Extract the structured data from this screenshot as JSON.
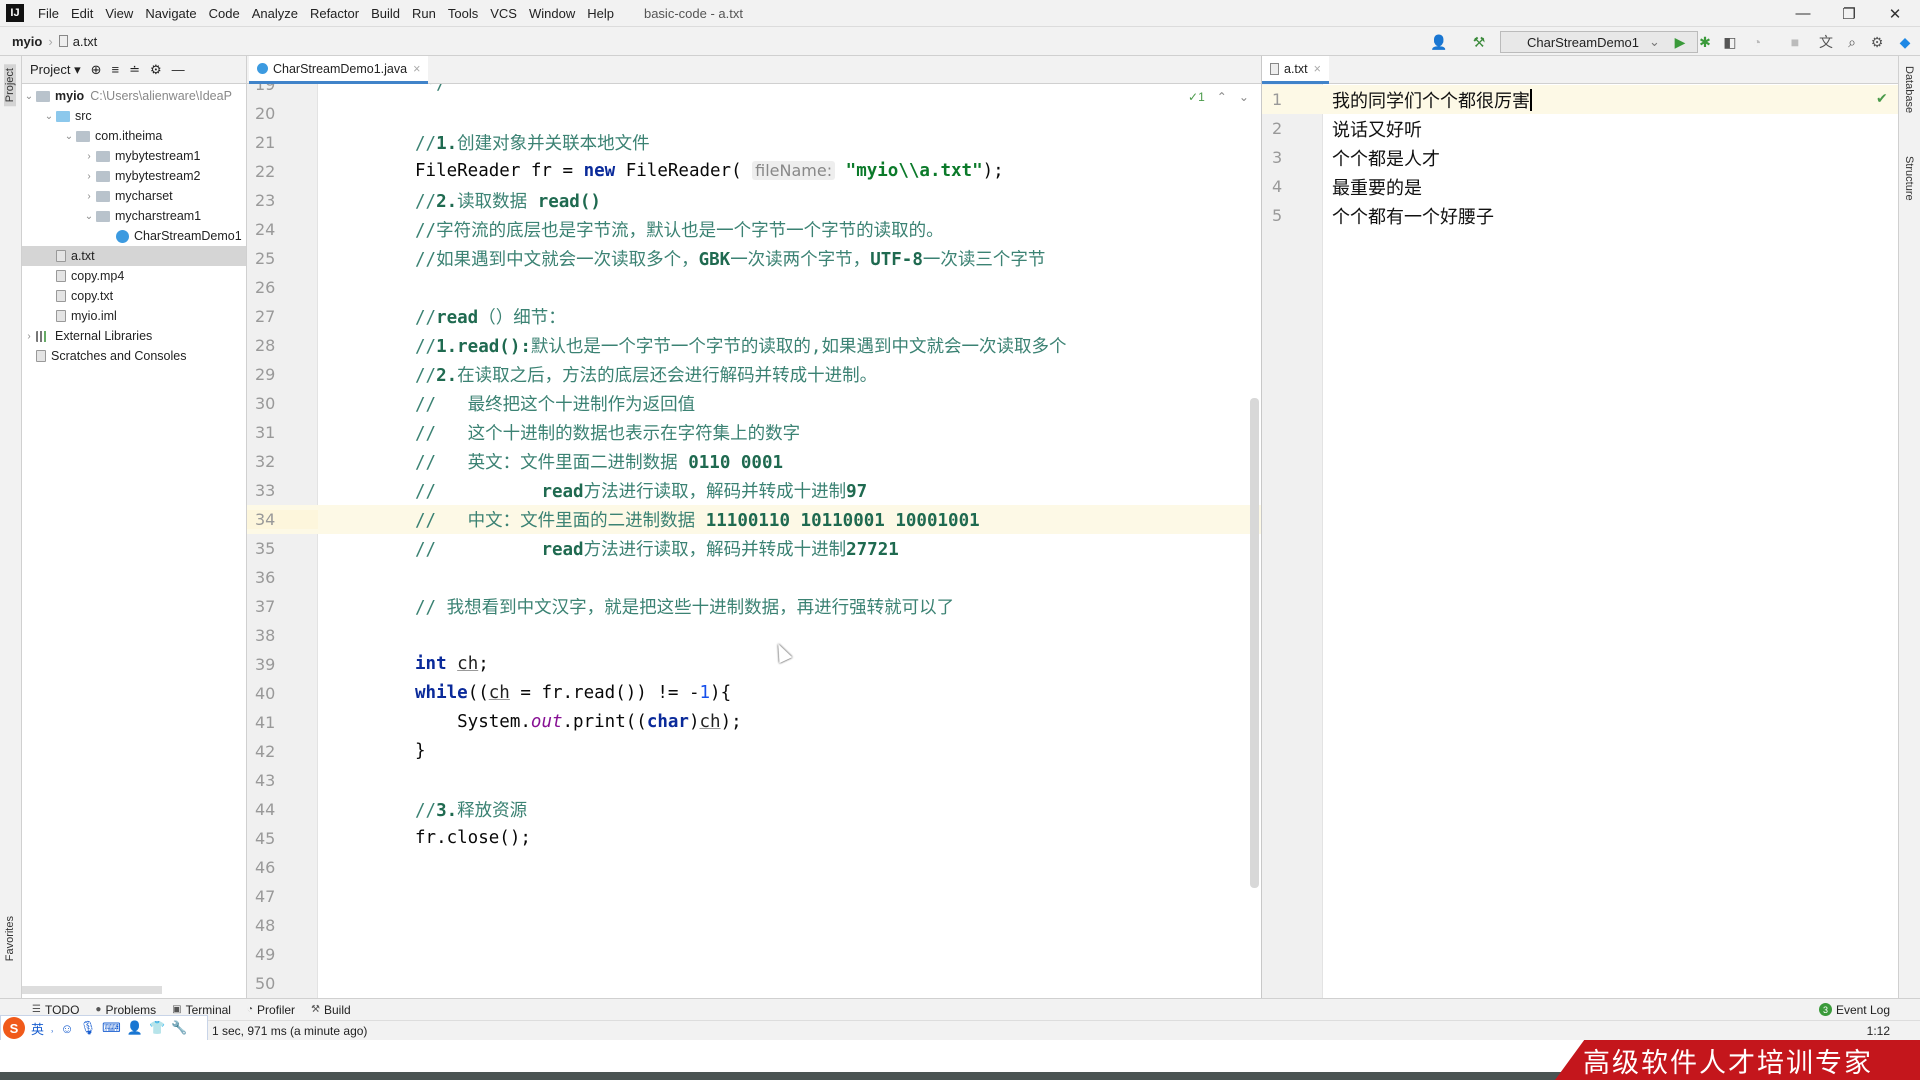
{
  "window": {
    "title": "basic-code - a.txt",
    "menu": [
      "File",
      "Edit",
      "View",
      "Navigate",
      "Code",
      "Analyze",
      "Refactor",
      "Build",
      "Run",
      "Tools",
      "VCS",
      "Window",
      "Help"
    ],
    "controls": {
      "minimize": "—",
      "restore": "❐",
      "close": "✕"
    }
  },
  "navbar": {
    "project": "myio",
    "file": "a.txt"
  },
  "toolbar": {
    "run_config": "CharStreamDemo1",
    "icons": [
      "user-icon",
      "hammer-icon",
      "run-icon",
      "debug-icon",
      "coverage-icon",
      "profile-icon",
      "stop-icon",
      "translate-icon",
      "search-icon",
      "gear-icon",
      "plugin-icon"
    ]
  },
  "project_panel": {
    "title": "Project",
    "tree": [
      {
        "label": "myio",
        "hint": "C:\\Users\\alienware\\IdeaP",
        "level": 0,
        "arrow": "⌄",
        "icon": "module",
        "bold": true
      },
      {
        "label": "src",
        "level": 1,
        "arrow": "⌄",
        "icon": "src"
      },
      {
        "label": "com.itheima",
        "level": 2,
        "arrow": "⌄",
        "icon": "pkg"
      },
      {
        "label": "mybytestream1",
        "level": 3,
        "arrow": "›",
        "icon": "pkg"
      },
      {
        "label": "mybytestream2",
        "level": 3,
        "arrow": "›",
        "icon": "pkg"
      },
      {
        "label": "mycharset",
        "level": 3,
        "arrow": "›",
        "icon": "pkg"
      },
      {
        "label": "mycharstream1",
        "level": 3,
        "arrow": "⌄",
        "icon": "pkg"
      },
      {
        "label": "CharStreamDemo1",
        "level": 4,
        "arrow": "",
        "icon": "cls"
      },
      {
        "label": "a.txt",
        "level": 1,
        "arrow": "",
        "icon": "file",
        "selected": true
      },
      {
        "label": "copy.mp4",
        "level": 1,
        "arrow": "",
        "icon": "file"
      },
      {
        "label": "copy.txt",
        "level": 1,
        "arrow": "",
        "icon": "file"
      },
      {
        "label": "myio.iml",
        "level": 1,
        "arrow": "",
        "icon": "file"
      },
      {
        "label": "External Libraries",
        "level": 0,
        "arrow": "›",
        "icon": "lib"
      },
      {
        "label": "Scratches and Consoles",
        "level": 0,
        "arrow": "",
        "icon": "file"
      }
    ]
  },
  "left_strip": {
    "top": "Project",
    "bottom": "Favorites"
  },
  "right_strip": {
    "top": "Database",
    "bottom": "Structure"
  },
  "editor": {
    "tab": "CharStreamDemo1.java",
    "inspection": "1",
    "current_line": 34,
    "lines": [
      {
        "n": "19",
        "t": [
          [
            "cm",
            " */"
          ]
        ]
      },
      {
        "n": "20",
        "t": []
      },
      {
        "n": "21",
        "t": [
          [
            "cm",
            "//"
          ],
          [
            "cmb",
            "1."
          ],
          [
            "cm",
            "创建对象并关联本地文件"
          ]
        ]
      },
      {
        "n": "22",
        "t": [
          [
            "pl",
            "FileReader fr = "
          ],
          [
            "kw",
            "new"
          ],
          [
            "pl",
            " FileReader( "
          ],
          [
            "hint",
            "fileName:"
          ],
          [
            "str",
            " \"myio\\\\a.txt\""
          ],
          [
            "pl",
            ");"
          ]
        ]
      },
      {
        "n": "23",
        "t": [
          [
            "cm",
            "//"
          ],
          [
            "cmb",
            "2."
          ],
          [
            "cm",
            "读取数据 "
          ],
          [
            "cmb",
            "read()"
          ]
        ]
      },
      {
        "n": "24",
        "t": [
          [
            "cm",
            "//字符流的底层也是字节流，默认也是一个字节一个字节的读取的。"
          ]
        ]
      },
      {
        "n": "25",
        "t": [
          [
            "cm",
            "//如果遇到中文就会一次读取多个，"
          ],
          [
            "cmb",
            "GBK"
          ],
          [
            "cm",
            "一次读两个字节，"
          ],
          [
            "cmb",
            "UTF-8"
          ],
          [
            "cm",
            "一次读三个字节"
          ]
        ]
      },
      {
        "n": "26",
        "t": []
      },
      {
        "n": "27",
        "t": [
          [
            "cm",
            "//"
          ],
          [
            "cmb",
            "read"
          ],
          [
            "cm",
            "（）细节："
          ]
        ]
      },
      {
        "n": "28",
        "t": [
          [
            "cm",
            "//"
          ],
          [
            "cmb",
            "1.read():"
          ],
          [
            "cm",
            "默认也是一个字节一个字节的读取的,如果遇到中文就会一次读取多个"
          ]
        ]
      },
      {
        "n": "29",
        "t": [
          [
            "cm",
            "//"
          ],
          [
            "cmb",
            "2."
          ],
          [
            "cm",
            "在读取之后，方法的底层还会进行解码并转成十进制。"
          ]
        ]
      },
      {
        "n": "30",
        "t": [
          [
            "cm",
            "//   最终把这个十进制作为返回值"
          ]
        ]
      },
      {
        "n": "31",
        "t": [
          [
            "cm",
            "//   这个十进制的数据也表示在字符集上的数字"
          ]
        ]
      },
      {
        "n": "32",
        "t": [
          [
            "cm",
            "//   英文：文件里面二进制数据 "
          ],
          [
            "cmb",
            "0110 0001"
          ]
        ]
      },
      {
        "n": "33",
        "t": [
          [
            "cm",
            "//          "
          ],
          [
            "cmb",
            "read"
          ],
          [
            "cm",
            "方法进行读取，解码并转成十进制"
          ],
          [
            "cmb",
            "97"
          ]
        ]
      },
      {
        "n": "34",
        "t": [
          [
            "cm",
            "//   中文：文件里面的二进制数据 "
          ],
          [
            "cmb",
            "11100110 10110001 10001001"
          ]
        ]
      },
      {
        "n": "35",
        "t": [
          [
            "cm",
            "//          "
          ],
          [
            "cmb",
            "read"
          ],
          [
            "cm",
            "方法进行读取，解码并转成十进制"
          ],
          [
            "cmb",
            "27721"
          ]
        ]
      },
      {
        "n": "36",
        "t": []
      },
      {
        "n": "37",
        "t": [
          [
            "cm",
            "// 我想看到中文汉字，就是把这些十进制数据，再进行强转就可以了"
          ]
        ]
      },
      {
        "n": "38",
        "t": []
      },
      {
        "n": "39",
        "t": [
          [
            "kw",
            "int"
          ],
          [
            "pl",
            " "
          ],
          [
            "ul",
            "ch"
          ],
          [
            "pl",
            ";"
          ]
        ]
      },
      {
        "n": "40",
        "t": [
          [
            "kw",
            "while"
          ],
          [
            "pl",
            "(("
          ],
          [
            "ul",
            "ch"
          ],
          [
            "pl",
            " = fr.read()) != -"
          ],
          [
            "num",
            "1"
          ],
          [
            "pl",
            "){"
          ]
        ]
      },
      {
        "n": "41",
        "t": [
          [
            "pl",
            "    System."
          ],
          [
            "it",
            "out"
          ],
          [
            "pl",
            ".print(("
          ],
          [
            "kw",
            "char"
          ],
          [
            "pl",
            ")"
          ],
          [
            "ul",
            "ch"
          ],
          [
            "pl",
            ");"
          ]
        ]
      },
      {
        "n": "42",
        "t": [
          [
            "pl",
            "}"
          ]
        ]
      },
      {
        "n": "43",
        "t": []
      },
      {
        "n": "44",
        "t": [
          [
            "cm",
            "//"
          ],
          [
            "cmb",
            "3."
          ],
          [
            "cm",
            "释放资源"
          ]
        ]
      },
      {
        "n": "45",
        "t": [
          [
            "pl",
            "fr.close();"
          ]
        ]
      },
      {
        "n": "46",
        "t": []
      },
      {
        "n": "47",
        "t": []
      },
      {
        "n": "48",
        "t": []
      },
      {
        "n": "49",
        "t": []
      },
      {
        "n": "50",
        "t": []
      }
    ]
  },
  "text_editor": {
    "tab": "a.txt",
    "current_line": 1,
    "lines": [
      "我的同学们个个都很厉害",
      "说话又好听",
      "个个都是人才",
      "最重要的是",
      "个个都有一个好腰子"
    ]
  },
  "bottom_tools": {
    "items": [
      "TODO",
      "Problems",
      "Terminal",
      "Profiler",
      "Build"
    ],
    "event_log": "Event Log",
    "event_count": "3"
  },
  "status": {
    "message": "1 sec, 971 ms (a minute ago)",
    "position": "1:12"
  },
  "ime": {
    "logo": "S",
    "mode": "英"
  },
  "watermark": "高级软件人才培训专家"
}
